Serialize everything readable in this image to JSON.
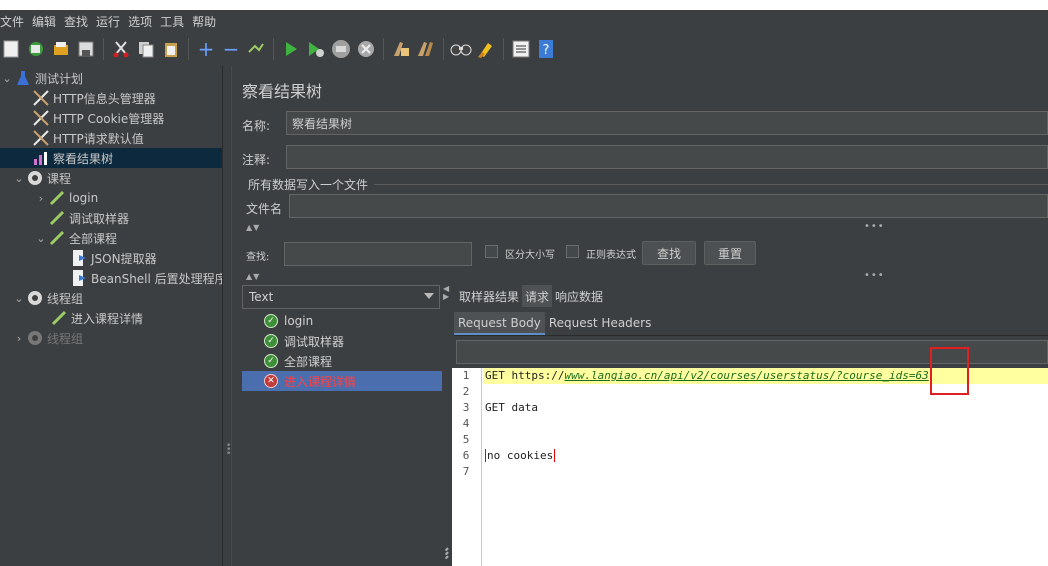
{
  "menu": [
    "文件",
    "编辑",
    "查找",
    "运行",
    "选项",
    "工具",
    "帮助"
  ],
  "tree": [
    {
      "label": "测试计划"
    },
    {
      "label": "HTTP信息头管理器"
    },
    {
      "label": "HTTP Cookie管理器"
    },
    {
      "label": "HTTP请求默认值"
    },
    {
      "label": "察看结果树"
    },
    {
      "label": "课程"
    },
    {
      "label": "login"
    },
    {
      "label": "调试取样器"
    },
    {
      "label": "全部课程"
    },
    {
      "label": "JSON提取器"
    },
    {
      "label": "BeanShell 后置处理程序"
    },
    {
      "label": "线程组"
    },
    {
      "label": "进入课程详情"
    },
    {
      "label": "线程组"
    }
  ],
  "panel": {
    "title": "察看结果树",
    "name_label": "名称:",
    "name_value": "察看结果树",
    "comment_label": "注释:",
    "comment_value": "",
    "write_all_label": "所有数据写入一个文件",
    "filename_label": "文件名",
    "filename_value": ""
  },
  "search": {
    "label": "查找:",
    "value": "",
    "case_label": "区分大小写",
    "regex_label": "正则表达式",
    "find_button": "查找",
    "reset_button": "重置"
  },
  "renderer": {
    "selected": "Text"
  },
  "results": [
    {
      "label": "login",
      "status": "ok"
    },
    {
      "label": "调试取样器",
      "status": "ok"
    },
    {
      "label": "全部课程",
      "status": "ok"
    },
    {
      "label": "进入课程详情",
      "status": "error"
    }
  ],
  "tabs": [
    "取样器结果",
    "请求",
    "响应数据"
  ],
  "active_tab": "请求",
  "subtabs": [
    "Request Body",
    "Request Headers"
  ],
  "active_subtab": "Request Body",
  "editor": {
    "line_numbers": [
      "1",
      "2",
      "3",
      "4",
      "5",
      "6",
      "7"
    ],
    "line1_prefix": "GET https://",
    "line1_url": "www.langiao.cn/api/v2/courses/userstatus/?course_ids=63",
    "line3": "GET data",
    "line6": "no cookies"
  },
  "colors": {
    "background": "#3c3f41",
    "selection": "#4b6eaf",
    "tree_selection": "#0d293e",
    "highlight_line": "#ffffa0",
    "annotation_red": "#e02020"
  }
}
